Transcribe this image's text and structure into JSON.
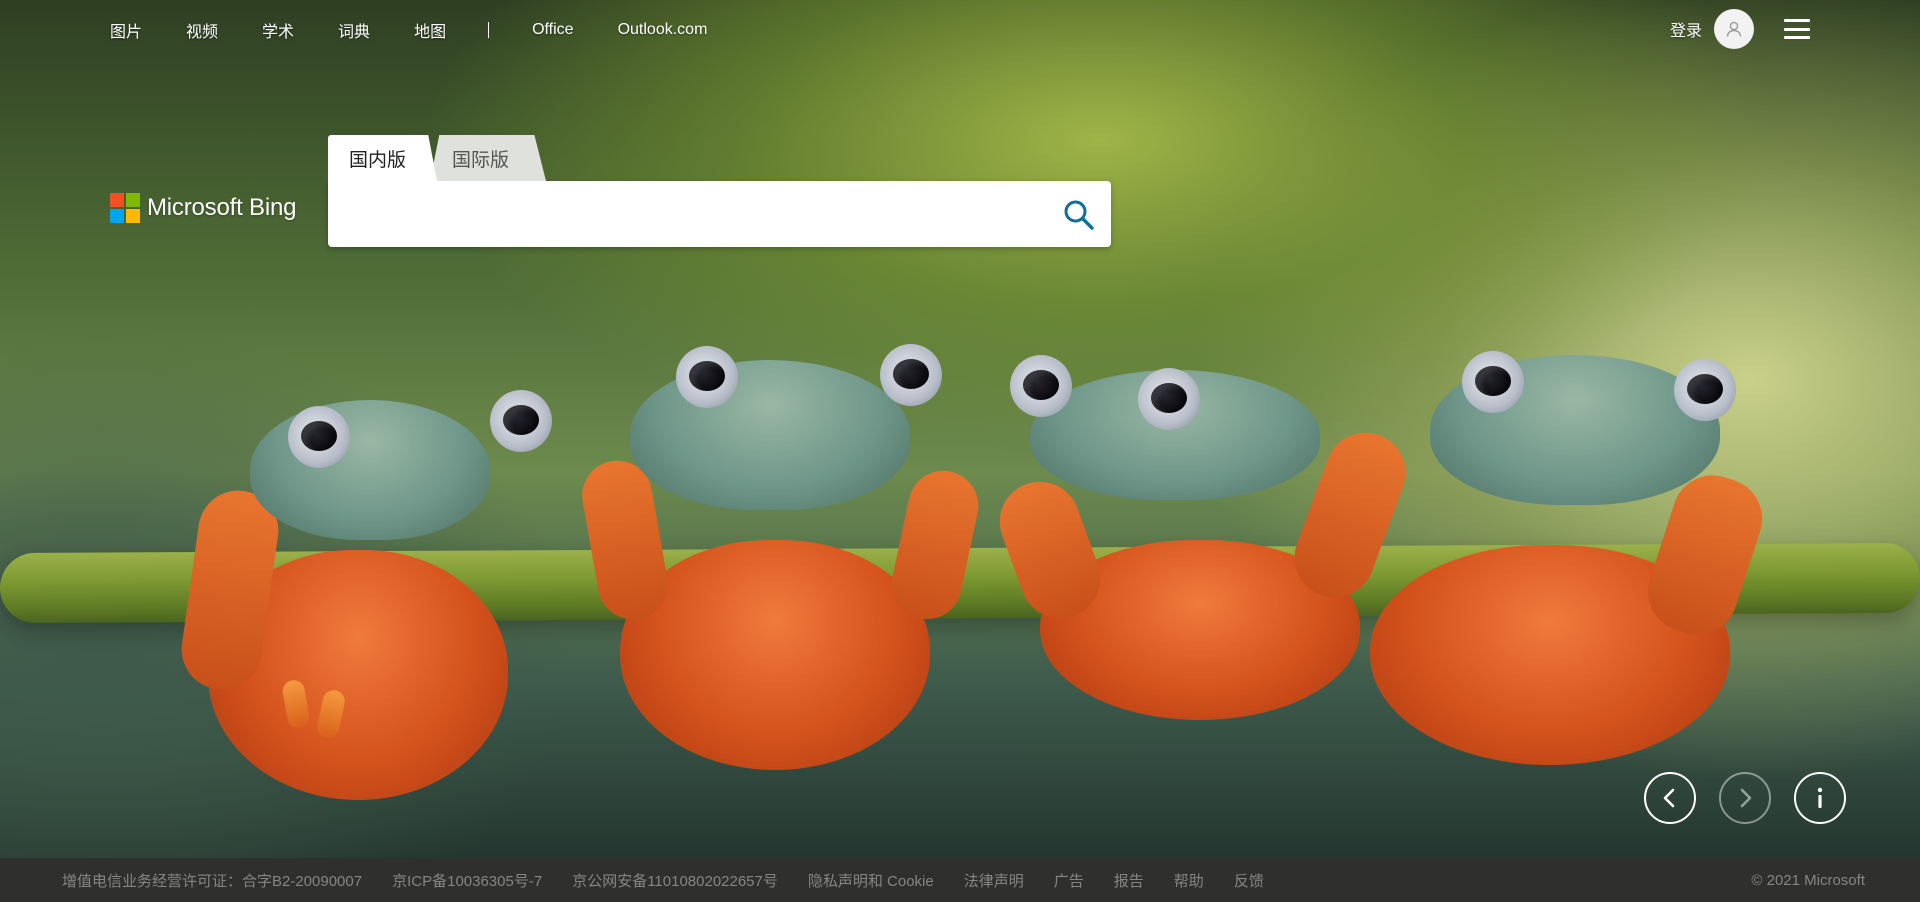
{
  "nav": {
    "links": [
      "图片",
      "视频",
      "学术",
      "词典",
      "地图"
    ],
    "separator": "|",
    "links2": [
      "Office",
      "Outlook.com"
    ]
  },
  "account": {
    "login_label": "登录",
    "avatar_icon": "user-icon",
    "menu_icon": "hamburger-menu-icon"
  },
  "brand": {
    "name": "Microsoft Bing",
    "colors": [
      "#f25022",
      "#7fba00",
      "#00a4ef",
      "#ffb900"
    ]
  },
  "search": {
    "tabs": [
      {
        "label": "国内版",
        "active": true
      },
      {
        "label": "国际版",
        "active": false
      }
    ],
    "value": "",
    "placeholder": "",
    "button_icon": "search-icon",
    "accent": "#0f6f9c"
  },
  "carousel": {
    "prev_icon": "chevron-left-icon",
    "next_icon": "chevron-right-icon",
    "info_icon": "info-icon"
  },
  "footer": {
    "items": [
      "增值电信业务经营许可证：合字B2-20090007",
      "京ICP备10036305号-7",
      "京公网安备11010802022657号",
      "隐私声明和 Cookie",
      "法律声明",
      "广告",
      "报告",
      "帮助",
      "反馈"
    ],
    "copyright": "© 2021 Microsoft"
  }
}
